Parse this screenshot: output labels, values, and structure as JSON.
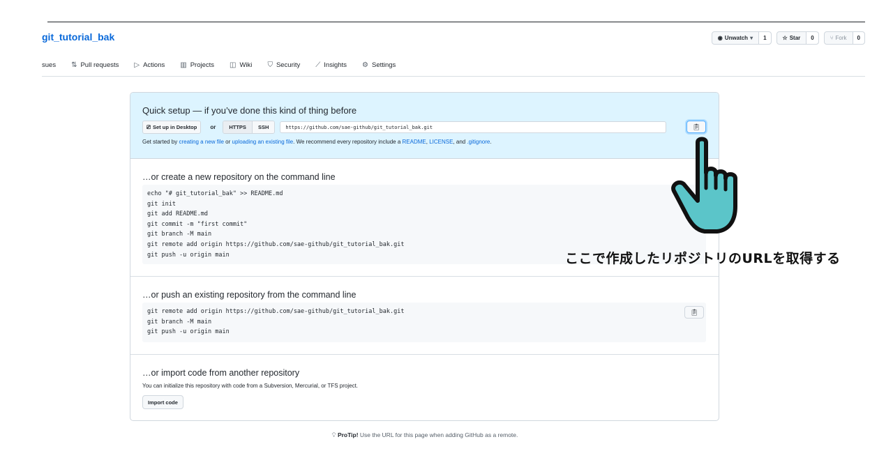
{
  "repo": {
    "name": "git_tutorial_bak",
    "unwatch_label": "Unwatch",
    "unwatch_count": "1",
    "star_label": "Star",
    "star_count": "0",
    "fork_label": "Fork",
    "fork_count": "0"
  },
  "nav": {
    "items": [
      {
        "label": "sues",
        "icon": "issue-icon"
      },
      {
        "label": "Pull requests",
        "icon": "pull-request-icon"
      },
      {
        "label": "Actions",
        "icon": "play-icon"
      },
      {
        "label": "Projects",
        "icon": "project-icon"
      },
      {
        "label": "Wiki",
        "icon": "book-icon"
      },
      {
        "label": "Security",
        "icon": "shield-icon"
      },
      {
        "label": "Insights",
        "icon": "graph-icon"
      },
      {
        "label": "Settings",
        "icon": "gear-icon"
      }
    ]
  },
  "quick_setup": {
    "title": "Quick setup — if you’ve done this kind of thing before",
    "desktop_btn": "Set up in Desktop",
    "or": "or",
    "https": "HTTPS",
    "ssh": "SSH",
    "url": "https://github.com/sae-github/git_tutorial_bak.git",
    "help_prefix": "Get started by ",
    "help_link1": "creating a new file",
    "help_mid": " or ",
    "help_link2": "uploading an existing file",
    "help_mid2": ". We recommend every repository include a ",
    "help_link3": "README",
    "help_sep": ", ",
    "help_link4": "LICENSE",
    "help_and": ", and ",
    "help_link5": ".gitignore",
    "help_end": "."
  },
  "create_section": {
    "title": "…or create a new repository on the command line",
    "code": "echo \"# git_tutorial_bak\" >> README.md\ngit init\ngit add README.md\ngit commit -m \"first commit\"\ngit branch -M main\ngit remote add origin https://github.com/sae-github/git_tutorial_bak.git\ngit push -u origin main"
  },
  "push_section": {
    "title": "…or push an existing repository from the command line",
    "code": "git remote add origin https://github.com/sae-github/git_tutorial_bak.git\ngit branch -M main\ngit push -u origin main"
  },
  "import_section": {
    "title": "…or import code from another repository",
    "desc": "You can initialize this repository with code from a Subversion, Mercurial, or TFS project.",
    "button": "Import code"
  },
  "protip": {
    "bold": "ProTip!",
    "text": " Use the URL for this page when adding GitHub as a remote."
  },
  "annotation": "ここで作成したリポジトリのURLを取得する",
  "colors": {
    "link": "#0969da",
    "quick_setup_bg": "#ddf4ff",
    "hand_fill": "#5bc5c9"
  }
}
